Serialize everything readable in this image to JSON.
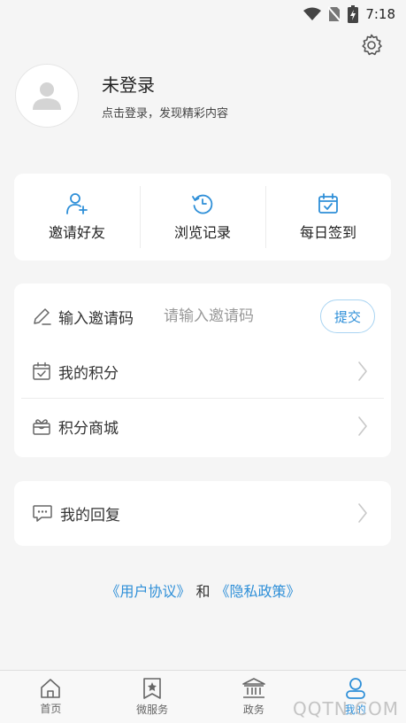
{
  "status_bar": {
    "time": "7:18"
  },
  "profile": {
    "name": "未登录",
    "subtitle": "点击登录，发现精彩内容"
  },
  "quick_actions": [
    {
      "label": "邀请好友",
      "icon": "add-user-icon"
    },
    {
      "label": "浏览记录",
      "icon": "history-icon"
    },
    {
      "label": "每日签到",
      "icon": "calendar-check-icon"
    }
  ],
  "invite": {
    "label": "输入邀请码",
    "placeholder": "请输入邀请码",
    "value": "",
    "submit_label": "提交"
  },
  "menu": {
    "points": "我的积分",
    "shop": "积分商城",
    "replies": "我的回复"
  },
  "agreement": {
    "user_agreement": "《用户协议》",
    "and": "和",
    "privacy_policy": "《隐私政策》"
  },
  "bottom_nav": [
    {
      "label": "首页",
      "icon": "home-icon",
      "active": false
    },
    {
      "label": "微服务",
      "icon": "star-bookmark-icon",
      "active": false
    },
    {
      "label": "政务",
      "icon": "government-building-icon",
      "active": false
    },
    {
      "label": "我的",
      "icon": "user-icon",
      "active": true
    }
  ],
  "watermark": "QQTN.COM",
  "colors": {
    "accent": "#2e8fd8",
    "background": "#f5f5f5",
    "card": "#ffffff"
  }
}
